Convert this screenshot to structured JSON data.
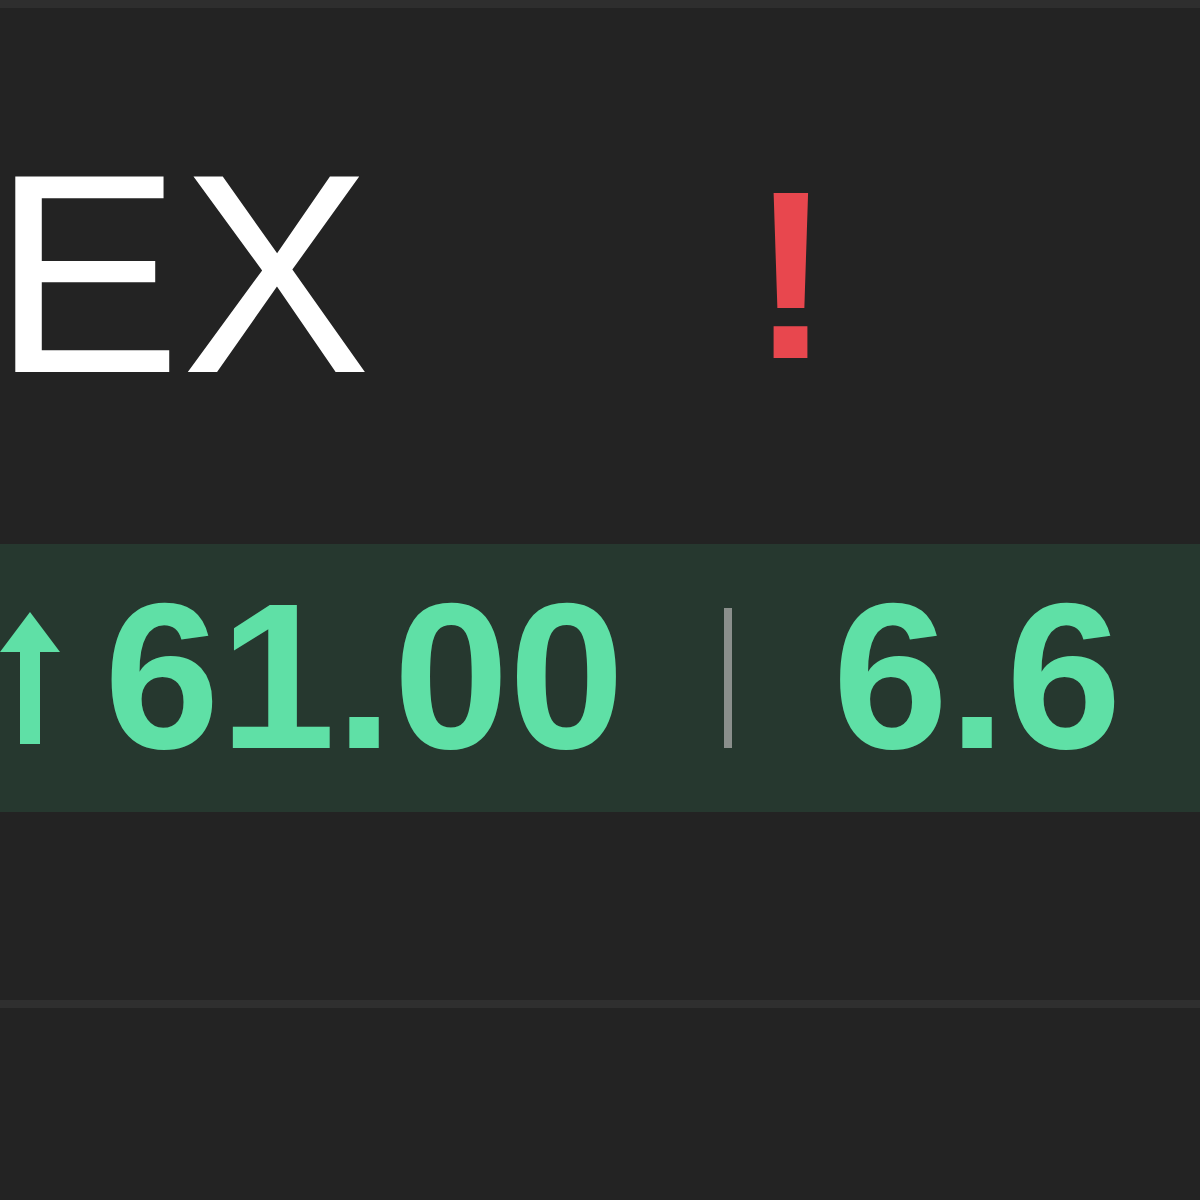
{
  "ticker": "EX",
  "alert": "!",
  "change": {
    "up": true,
    "value": "61.00",
    "percent": "6.6"
  }
}
